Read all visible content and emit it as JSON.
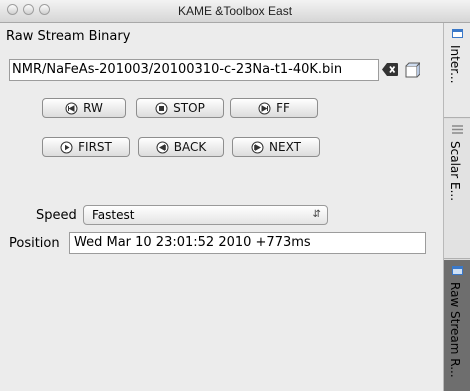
{
  "window": {
    "title": "KAME &Toolbox East"
  },
  "panel": {
    "title": "Raw Stream Binary",
    "file_path": "NMR/NaFeAs-201003/20100310-c-23Na-t1-40K.bin",
    "buttons": {
      "rw": "RW",
      "stop": "STOP",
      "ff": "FF",
      "first": "FIRST",
      "back": "BACK",
      "next": "NEXT"
    },
    "speed": {
      "label": "Speed",
      "value": "Fastest"
    },
    "position": {
      "label": "Position",
      "value": "Wed Mar 10 23:01:52 2010 +773ms"
    }
  },
  "sidebar": {
    "tabs": [
      {
        "label": "Inter...",
        "icon": "doc-icon"
      },
      {
        "label": "Scalar E...",
        "icon": "list-icon"
      },
      {
        "label": "Raw Stream R...",
        "icon": "stream-icon"
      }
    ]
  },
  "colors": {
    "accent_blue": "#3a78c8",
    "selected_tab": "#6e6e6e"
  }
}
